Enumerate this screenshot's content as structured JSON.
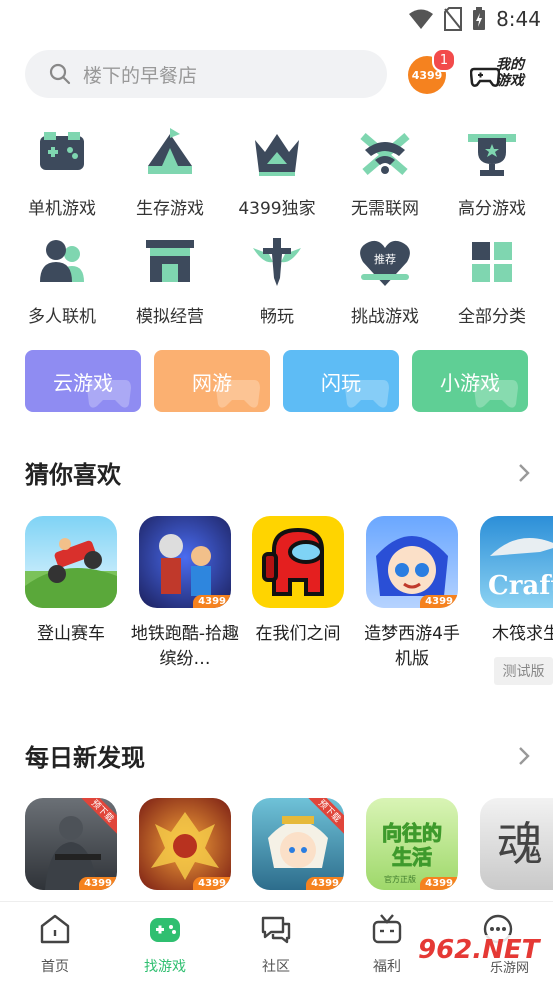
{
  "status_bar": {
    "time": "8:44"
  },
  "search": {
    "placeholder": "楼下的早餐店"
  },
  "header": {
    "badge_text": "4399",
    "badge_count": "1",
    "my_games_label_1": "我的",
    "my_games_label_2": "游戏"
  },
  "categories": [
    {
      "label": "单机游戏",
      "icon": "gamepad-icon"
    },
    {
      "label": "生存游戏",
      "icon": "tent-icon"
    },
    {
      "label": "4399独家",
      "icon": "crown-icon"
    },
    {
      "label": "无需联网",
      "icon": "wifi-off-icon"
    },
    {
      "label": "高分游戏",
      "icon": "trophy-icon"
    },
    {
      "label": "多人联机",
      "icon": "multiplayer-icon"
    },
    {
      "label": "模拟经营",
      "icon": "shop-icon"
    },
    {
      "label": "畅玩",
      "icon": "sword-icon"
    },
    {
      "label": "挑战游戏",
      "icon": "heart-recommend-icon"
    },
    {
      "label": "全部分类",
      "icon": "grid-icon"
    }
  ],
  "category_badge_text": "推荐",
  "quick_buttons": [
    {
      "label": "云游戏",
      "color": "#8f8cf2"
    },
    {
      "label": "网游",
      "color": "#fbb071"
    },
    {
      "label": "闪玩",
      "color": "#5ebcf5"
    },
    {
      "label": "小游戏",
      "color": "#5fcf95"
    }
  ],
  "section_guess": {
    "title": "猜你喜欢",
    "games": [
      {
        "name": "登山赛车",
        "badge": ""
      },
      {
        "name": "地铁跑酷-拾趣缤纷…",
        "badge": "4399"
      },
      {
        "name": "在我们之间",
        "badge": ""
      },
      {
        "name": "造梦西游4手机版",
        "badge": "4399"
      },
      {
        "name": "木筏求生",
        "badge": ""
      }
    ],
    "beta_tag": "测试版",
    "raft_icon_text": "Craft"
  },
  "section_new": {
    "title": "每日新发现",
    "games": [
      {
        "badge": "4399",
        "ribbon": "预下载"
      },
      {
        "badge": "4399",
        "ribbon": ""
      },
      {
        "badge": "4399",
        "ribbon": "预下载"
      },
      {
        "badge": "4399",
        "ribbon": "",
        "art_text": "向往的生活",
        "sub": "官方正版"
      },
      {
        "badge": "",
        "ribbon": "",
        "art_text": "魂"
      }
    ]
  },
  "tabbar": [
    {
      "label": "首页",
      "icon": "home-icon",
      "active": false
    },
    {
      "label": "找游戏",
      "icon": "gamepad-icon",
      "active": true
    },
    {
      "label": "社区",
      "icon": "chat-icon",
      "active": false
    },
    {
      "label": "福利",
      "icon": "gift-icon",
      "active": false
    },
    {
      "label": "",
      "icon": "more-icon",
      "active": false
    }
  ],
  "watermark": {
    "line1": "962.NET",
    "line2": "乐游网"
  },
  "colors": {
    "accent_green": "#2fbf70",
    "icon_dark": "#3d4a5c",
    "icon_mint": "#7fd6b0",
    "orange": "#f5821f"
  }
}
